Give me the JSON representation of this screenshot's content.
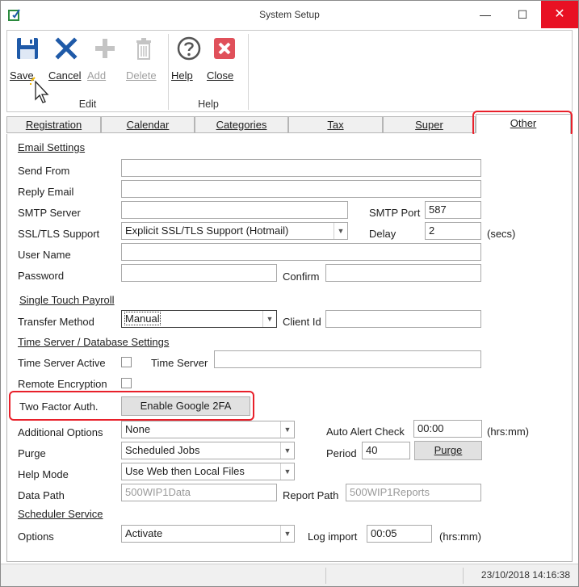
{
  "window": {
    "title": "System Setup",
    "controls": {
      "minimize": "—",
      "maximize": "☐",
      "close": "✕"
    }
  },
  "ribbon": {
    "buttons": [
      {
        "label": "Save",
        "icon": "save-icon",
        "enabled": true
      },
      {
        "label": "Cancel",
        "icon": "cancel-icon",
        "enabled": true
      },
      {
        "label": "Add",
        "icon": "add-icon",
        "enabled": false
      },
      {
        "label": "Delete",
        "icon": "delete-icon",
        "enabled": false
      },
      {
        "label": "Help",
        "icon": "help-icon",
        "enabled": true
      },
      {
        "label": "Close",
        "icon": "close-icon",
        "enabled": true
      }
    ],
    "groups": [
      "Edit",
      "Help"
    ]
  },
  "tabs": [
    "Registration",
    "Calendar",
    "Categories",
    "Tax",
    "Super",
    "Other"
  ],
  "active_tab": "Other",
  "email": {
    "section": "Email Settings",
    "send_from_label": "Send From",
    "send_from": "",
    "reply_email_label": "Reply Email",
    "reply_email": "",
    "smtp_server_label": "SMTP Server",
    "smtp_server": "",
    "smtp_port_label": "SMTP Port",
    "smtp_port": "587",
    "ssl_label": "SSL/TLS Support",
    "ssl_value": "Explicit SSL/TLS Support (Hotmail)",
    "delay_label": "Delay",
    "delay": "2",
    "delay_unit": "(secs)",
    "username_label": "User Name",
    "username": "",
    "password_label": "Password",
    "password": "",
    "confirm_label": "Confirm",
    "confirm": ""
  },
  "stp": {
    "section": "Single Touch Payroll",
    "transfer_label": "Transfer Method",
    "transfer_value": "Manual",
    "client_id_label": "Client Id",
    "client_id": ""
  },
  "timeserver": {
    "section": "Time Server / Database Settings",
    "active_label": "Time Server Active",
    "active": false,
    "server_label": "Time Server",
    "server": "",
    "remote_label": "Remote Encryption",
    "remote": false
  },
  "twofa": {
    "label": "Two Factor Auth.",
    "button": "Enable Google 2FA"
  },
  "options": {
    "additional_label": "Additional Options",
    "additional_value": "None",
    "auto_alert_label": "Auto Alert Check",
    "auto_alert": "00:00",
    "hrsmm": "(hrs:mm)",
    "purge_label": "Purge",
    "purge_value": "Scheduled Jobs",
    "period_label": "Period",
    "period": "40",
    "purge_button": "Purge",
    "help_mode_label": "Help Mode",
    "help_mode_value": "Use Web then Local Files",
    "data_path_label": "Data Path",
    "data_path": "500WIP1Data",
    "report_path_label": "Report Path",
    "report_path": "500WIP1Reports"
  },
  "scheduler": {
    "section": "Scheduler Service",
    "options_label": "Options",
    "options_value": "Activate",
    "log_import_label": "Log import",
    "log_import": "00:05",
    "hrsmm": "(hrs:mm)"
  },
  "status": {
    "datetime": "23/10/2018 14:16:38"
  },
  "colors": {
    "highlight": "#e8202a",
    "save": "#1f5aa8",
    "cancel": "#1f5aa8",
    "close": "#e81123"
  }
}
